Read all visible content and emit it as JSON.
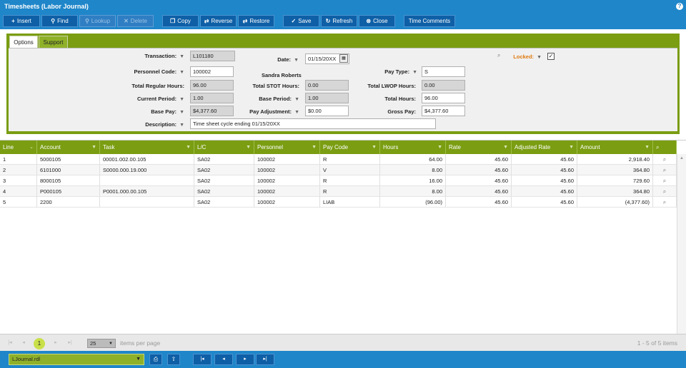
{
  "window": {
    "title": "Timesheets (Labor Journal)",
    "help": "?"
  },
  "toolbar": {
    "insert": "Insert",
    "find": "Find",
    "lookup": "Lookup",
    "delete": "Delete",
    "copy": "Copy",
    "reverse": "Reverse",
    "restore": "Restore",
    "save": "Save",
    "refresh": "Refresh",
    "close": "Close",
    "time_comments": "Time Comments"
  },
  "tabs": {
    "options": "Options",
    "support": "Support"
  },
  "form": {
    "transaction_label": "Transaction:",
    "transaction": "L101180",
    "date_label": "Date:",
    "date": "01/15/20XX",
    "locked_label": "Locked:",
    "locked_check": "✓",
    "personnel_code_label": "Personnel Code:",
    "personnel_code": "100002",
    "personnel_name": "Sandra Roberts",
    "pay_type_label": "Pay Type:",
    "pay_type": "S",
    "total_regular_hours_label": "Total Regular Hours:",
    "total_regular_hours": "96.00",
    "total_stot_hours_label": "Total STOT Hours:",
    "total_stot_hours": "0.00",
    "total_lwop_hours_label": "Total LWOP Hours:",
    "total_lwop_hours": "0.00",
    "current_period_label": "Current Period:",
    "current_period": "1.00",
    "base_period_label": "Base Period:",
    "base_period": "1.00",
    "total_hours_label": "Total Hours:",
    "total_hours": "96.00",
    "base_pay_label": "Base Pay:",
    "base_pay": "$4,377.60",
    "pay_adjustment_label": "Pay Adjustment:",
    "pay_adjustment": "$0.00",
    "gross_pay_label": "Gross Pay:",
    "gross_pay": "$4,377.60",
    "description_label": "Description:",
    "description": "Time sheet cycle ending 01/15/20XX"
  },
  "grid": {
    "columns": [
      "Line",
      "Account",
      "Task",
      "L/C",
      "Personnel",
      "Pay Code",
      "Hours",
      "Rate",
      "Adjusted Rate",
      "Amount"
    ],
    "rows": [
      {
        "line": "1",
        "account": "5000105",
        "task": "00001.002.00.105",
        "lc": "SA02",
        "personnel": "100002",
        "pay_code": "R",
        "hours": "64.00",
        "rate": "45.60",
        "adj_rate": "45.60",
        "amount": "2,918.40"
      },
      {
        "line": "2",
        "account": "6101000",
        "task": "S0000.000.19.000",
        "lc": "SA02",
        "personnel": "100002",
        "pay_code": "V",
        "hours": "8.00",
        "rate": "45.60",
        "adj_rate": "45.60",
        "amount": "364.80"
      },
      {
        "line": "3",
        "account": "8000105",
        "task": "",
        "lc": "SA02",
        "personnel": "100002",
        "pay_code": "R",
        "hours": "16.00",
        "rate": "45.60",
        "adj_rate": "45.60",
        "amount": "729.60"
      },
      {
        "line": "4",
        "account": "P000105",
        "task": "P0001.000.00.105",
        "lc": "SA02",
        "personnel": "100002",
        "pay_code": "R",
        "hours": "8.00",
        "rate": "45.60",
        "adj_rate": "45.60",
        "amount": "364.80"
      },
      {
        "line": "5",
        "account": "2200",
        "task": "",
        "lc": "SA02",
        "personnel": "100002",
        "pay_code": "LIAB",
        "hours": "(96.00)",
        "rate": "45.60",
        "adj_rate": "45.60",
        "amount": "(4,377.60)"
      }
    ]
  },
  "pager": {
    "current_page": "1",
    "page_size": "25",
    "items_per_page": "items per page",
    "count": "1 - 5 of 5 items"
  },
  "bottom": {
    "report": "LJournal.rdl"
  }
}
